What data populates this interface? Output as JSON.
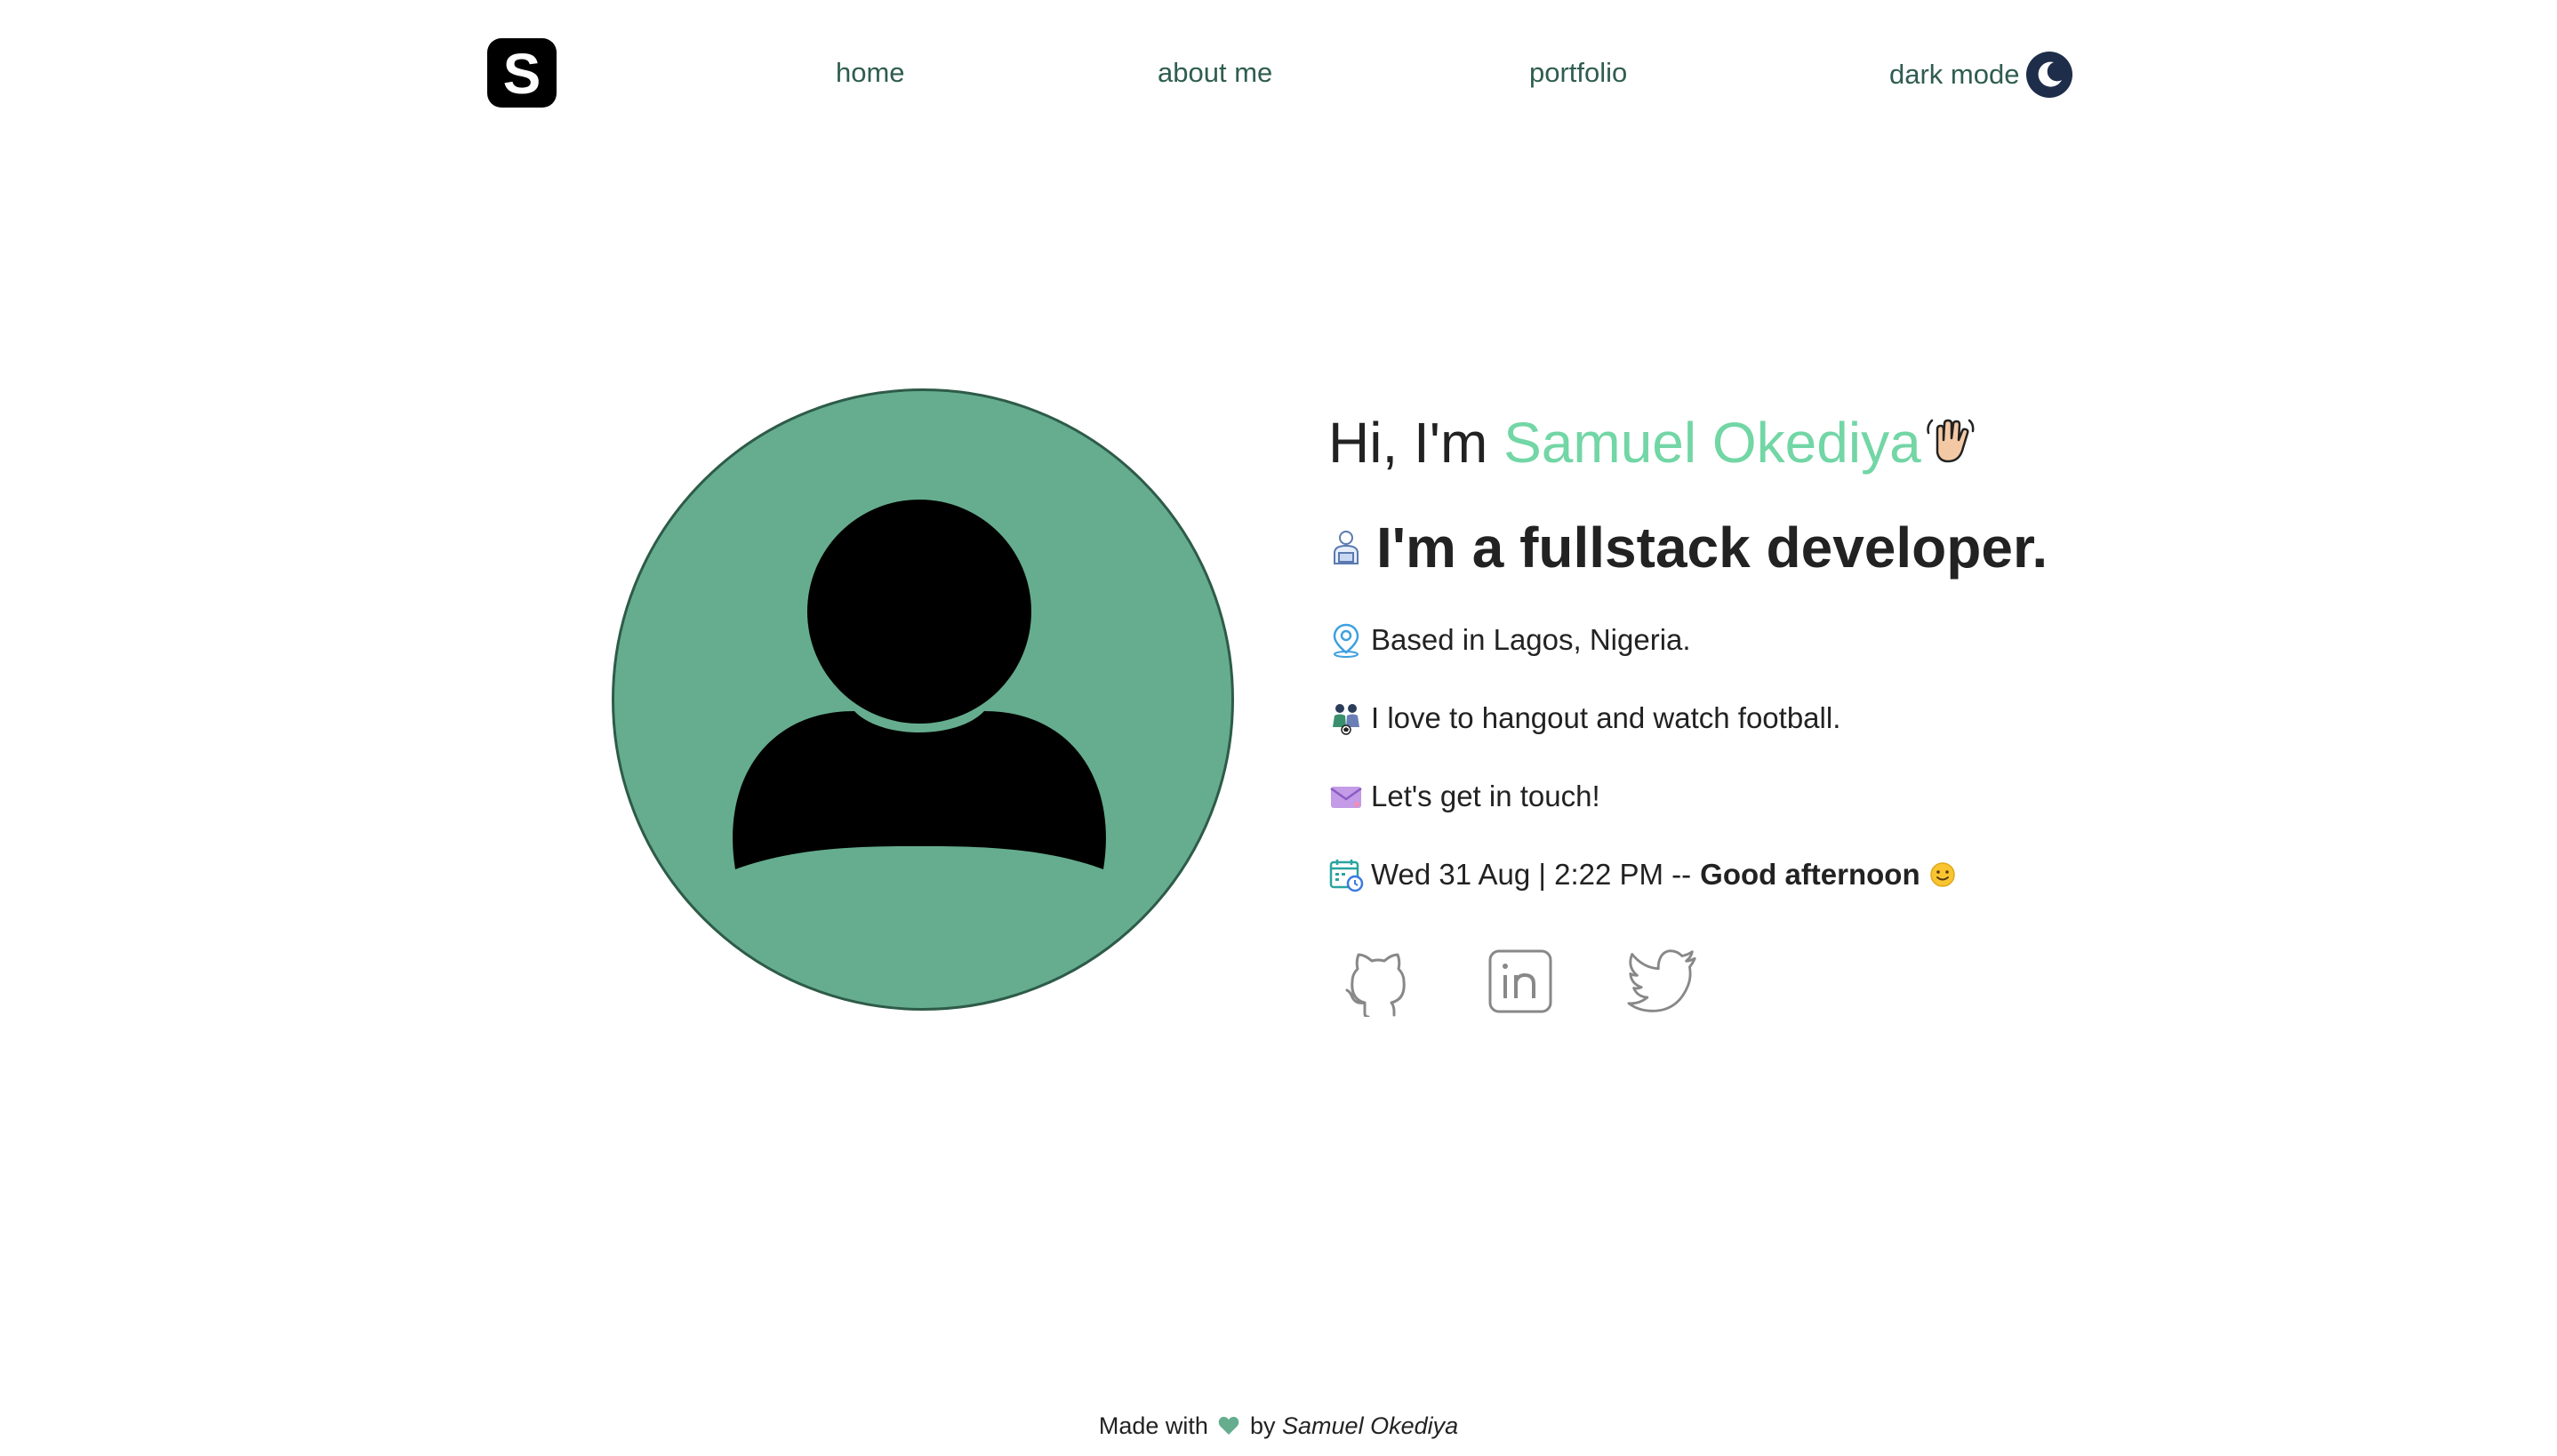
{
  "header": {
    "logo_letter": "S",
    "nav": {
      "home": "home",
      "about": "about me",
      "portfolio": "portfolio",
      "dark_mode": "dark mode"
    }
  },
  "intro": {
    "greeting_prefix": "Hi, I'm ",
    "name": "Samuel Okediya",
    "role": "I'm a fullstack developer.",
    "location": "Based in Lagos, Nigeria.",
    "hobby": "I love to hangout and watch football.",
    "contact": "Let's get in touch!",
    "datetime": "Wed 31 Aug | 2:22 PM --",
    "salutation": "Good afternoon"
  },
  "socials": [
    "github-icon",
    "linkedin-icon",
    "twitter-icon"
  ],
  "footer": {
    "made_with": "Made with",
    "by": "by",
    "author": "Samuel Okediya"
  },
  "colors": {
    "accent": "#72d6a5",
    "avatar_bg": "#65ad8e",
    "nav_text": "#2f5d50",
    "heart": "#65ad8e"
  }
}
